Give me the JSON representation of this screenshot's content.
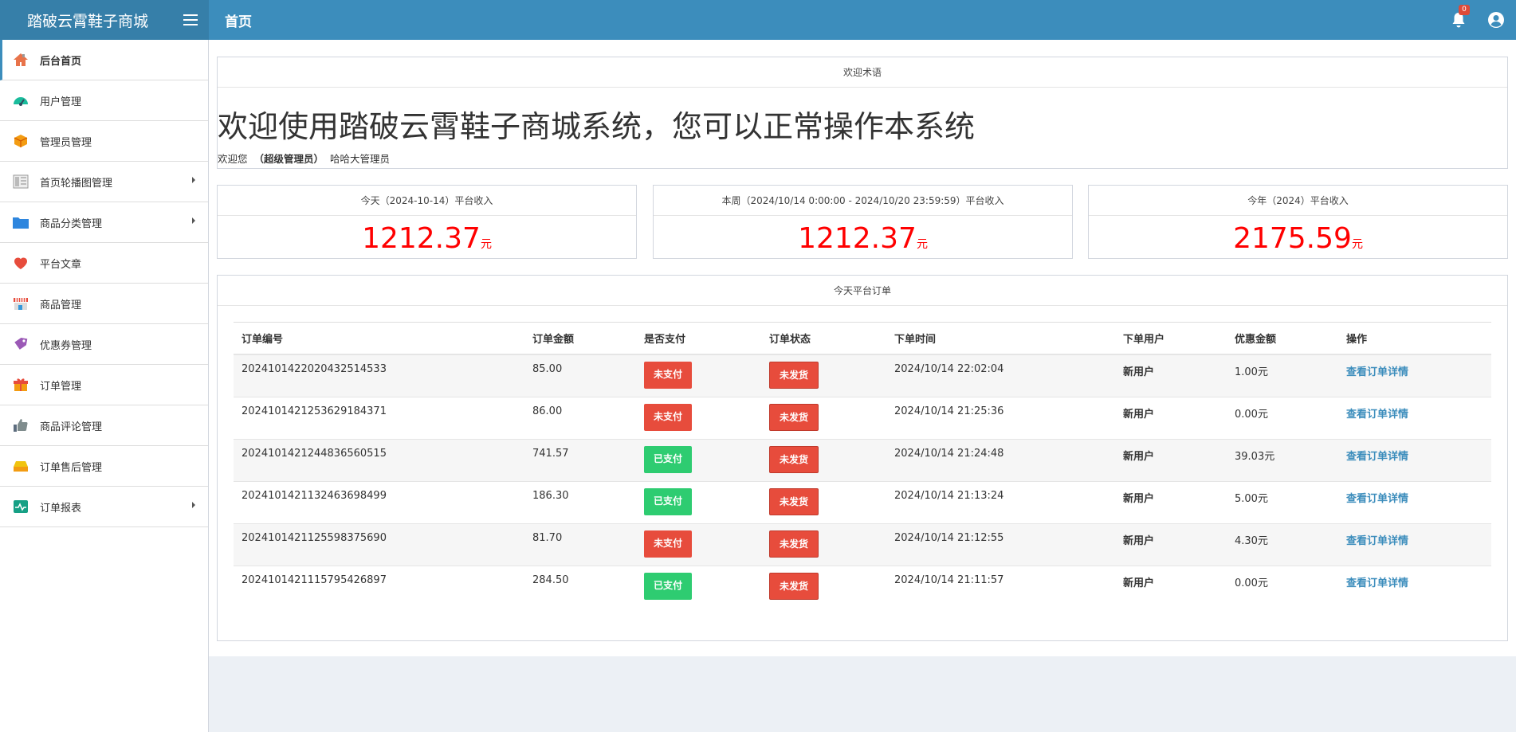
{
  "brand": {
    "name": "踏破云霄鞋子商城"
  },
  "header": {
    "title": "首页",
    "notification_count": "0"
  },
  "sidebar": {
    "items": [
      {
        "label": "后台首页",
        "icon": "home-icon",
        "active": true,
        "submenu": false
      },
      {
        "label": "用户管理",
        "icon": "dashboard-icon",
        "submenu": false
      },
      {
        "label": "管理员管理",
        "icon": "cube-icon",
        "submenu": false
      },
      {
        "label": "首页轮播图管理",
        "icon": "layout-icon",
        "submenu": true
      },
      {
        "label": "商品分类管理",
        "icon": "folder-icon",
        "submenu": true
      },
      {
        "label": "平台文章",
        "icon": "heart-icon",
        "submenu": false
      },
      {
        "label": "商品管理",
        "icon": "store-icon",
        "submenu": false
      },
      {
        "label": "优惠券管理",
        "icon": "tag-icon",
        "submenu": false
      },
      {
        "label": "订单管理",
        "icon": "gift-icon",
        "submenu": false
      },
      {
        "label": "商品评论管理",
        "icon": "thumbs-up-icon",
        "submenu": false
      },
      {
        "label": "订单售后管理",
        "icon": "inbox-icon",
        "submenu": false
      },
      {
        "label": "订单报表",
        "icon": "chart-icon",
        "submenu": true
      }
    ]
  },
  "welcome": {
    "header": "欢迎术语",
    "title": "欢迎使用踏破云霄鞋子商城系统，您可以正常操作本系统",
    "prefix": "欢迎您",
    "role": "（超级管理员）",
    "username": "哈哈大管理员"
  },
  "stats": [
    {
      "label": "今天（2024-10-14）平台收入",
      "value": "1212.37",
      "unit": "元"
    },
    {
      "label": "本周（2024/10/14 0:00:00 - 2024/10/20 23:59:59）平台收入",
      "value": "1212.37",
      "unit": "元"
    },
    {
      "label": "今年（2024）平台收入",
      "value": "2175.59",
      "unit": "元"
    }
  ],
  "orders": {
    "header": "今天平台订单",
    "columns": [
      "订单编号",
      "订单金额",
      "是否支付",
      "订单状态",
      "下单时间",
      "下单用户",
      "优惠金额",
      "操作"
    ],
    "rows": [
      {
        "id": "20241014220204325145 33",
        "amount": "85.00",
        "paid": "未支付",
        "paid_color": "#e74c3c",
        "status": "未发货",
        "time": "2024/10/14 22:02:04",
        "user": "新用户",
        "discount": "1.00元",
        "action": "查看订单详情"
      },
      {
        "id": "202410142125362918437 1",
        "amount": "86.00",
        "paid": "未支付",
        "paid_color": "#e74c3c",
        "status": "未发货",
        "time": "2024/10/14 21:25:36",
        "user": "新用户",
        "discount": "0.00元",
        "action": "查看订单详情"
      },
      {
        "id": "20241014212448365605 15",
        "amount": "741.57",
        "paid": "已支付",
        "paid_color": "#2ecc71",
        "status": "未发货",
        "time": "2024/10/14 21:24:48",
        "user": "新用户",
        "discount": "39.03元",
        "action": "查看订单详情"
      },
      {
        "id": "20241014211324636984 99",
        "amount": "186.30",
        "paid": "已支付",
        "paid_color": "#2ecc71",
        "status": "未发货",
        "time": "2024/10/14 21:13:24",
        "user": "新用户",
        "discount": "5.00元",
        "action": "查看订单详情"
      },
      {
        "id": "20241014211255983756 90",
        "amount": "81.70",
        "paid": "未支付",
        "paid_color": "#e74c3c",
        "status": "未发货",
        "time": "2024/10/14 21:12:55",
        "user": "新用户",
        "discount": "4.30元",
        "action": "查看订单详情"
      },
      {
        "id": "20241014211157954268 97",
        "amount": "284.50",
        "paid": "已支付",
        "paid_color": "#2ecc71",
        "status": "未发货",
        "time": "2024/10/14 21:11:57",
        "user": "新用户",
        "discount": "0.00元",
        "action": "查看订单详情"
      }
    ]
  }
}
